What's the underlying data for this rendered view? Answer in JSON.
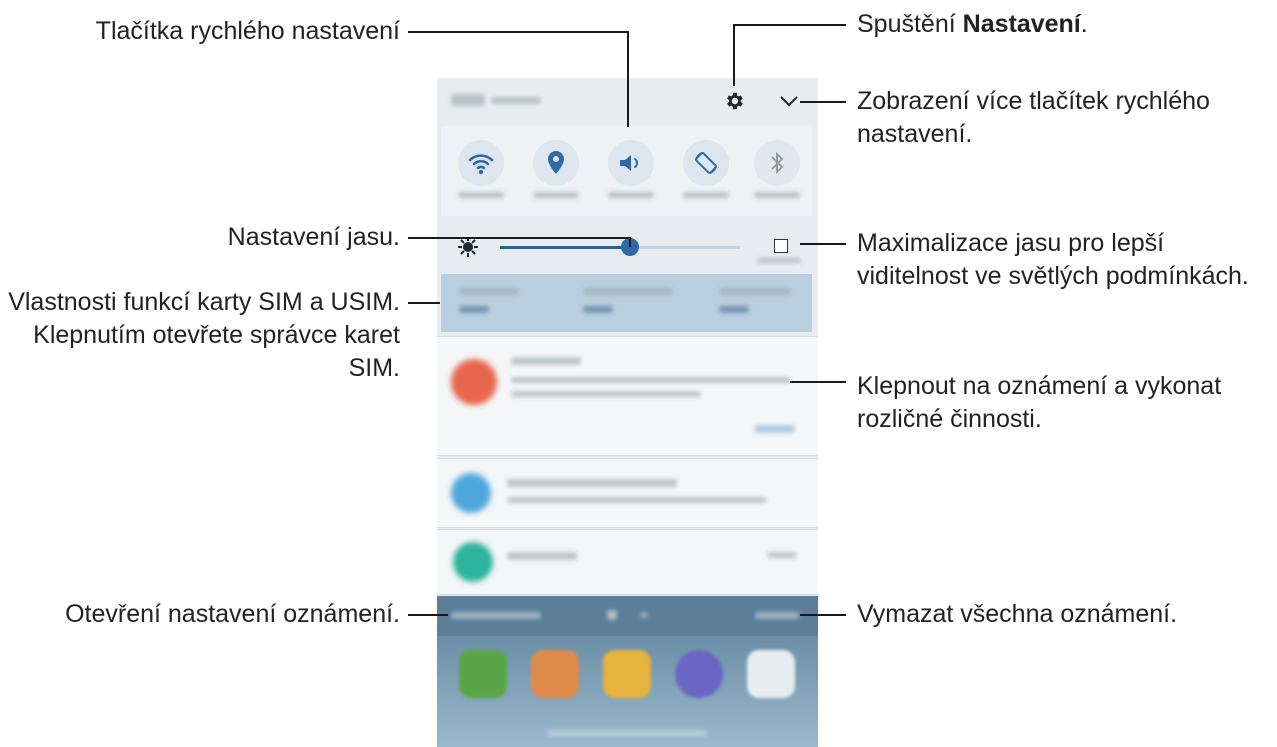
{
  "annotations": {
    "quick_settings": "Tlačítka rychlého nastavení",
    "settings_prefix": "Spuštění ",
    "settings_bold": "Nastavení",
    "settings_suffix": ".",
    "more_buttons_1": "Zobrazení více tlačítek rychlého",
    "more_buttons_2": "nastavení.",
    "brightness": "Nastavení jasu.",
    "max_brightness_1": "Maximalizace jasu pro lepší",
    "max_brightness_2": "viditelnost ve světlých podmínkách.",
    "sim_1": "Vlastnosti funkcí karty SIM a USIM.",
    "sim_2": "Klepnutím otevřete správce karet",
    "sim_3": "SIM.",
    "notification_1": "Klepnout na oznámení a vykonat",
    "notification_2": "rozličné činnosti.",
    "notif_settings": "Otevření nastavení oznámení.",
    "clear_all": "Vymazat všechna oznámení."
  },
  "icons": {
    "settings": "gear-icon",
    "expand": "chevron-down-icon",
    "quick_buttons": [
      "wifi-icon",
      "location-icon",
      "sound-icon",
      "rotate-icon",
      "bluetooth-icon"
    ],
    "brightness": "brightness-icon",
    "outdoor": "checkbox-icon",
    "apps": [
      "phone-app-icon",
      "contacts-app-icon",
      "email-app-icon",
      "internet-app-icon",
      "apps-grid-icon"
    ]
  },
  "colors": {
    "accent": "#2f6aa6",
    "notification_red": "#e8664e",
    "notification_blue": "#4ea7dc",
    "notification_teal": "#2db39e"
  },
  "brightness_level": 0.54
}
